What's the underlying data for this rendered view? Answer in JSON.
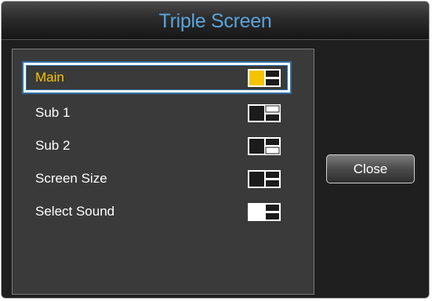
{
  "dialog": {
    "title": "Triple Screen",
    "title_color": "#5aa4dc",
    "selected_color": "#f5c400"
  },
  "menu": {
    "items": [
      {
        "label": "Main",
        "selected": true,
        "icon": "triple-screen-main-highlight-icon"
      },
      {
        "label": "Sub 1",
        "selected": false,
        "icon": "triple-screen-sub1-highlight-icon"
      },
      {
        "label": "Sub 2",
        "selected": false,
        "icon": "triple-screen-sub2-highlight-icon"
      },
      {
        "label": "Screen Size",
        "selected": false,
        "icon": "triple-screen-layout-icon"
      },
      {
        "label": "Select Sound",
        "selected": false,
        "icon": "triple-screen-sound-icon"
      }
    ]
  },
  "buttons": {
    "close_label": "Close"
  }
}
